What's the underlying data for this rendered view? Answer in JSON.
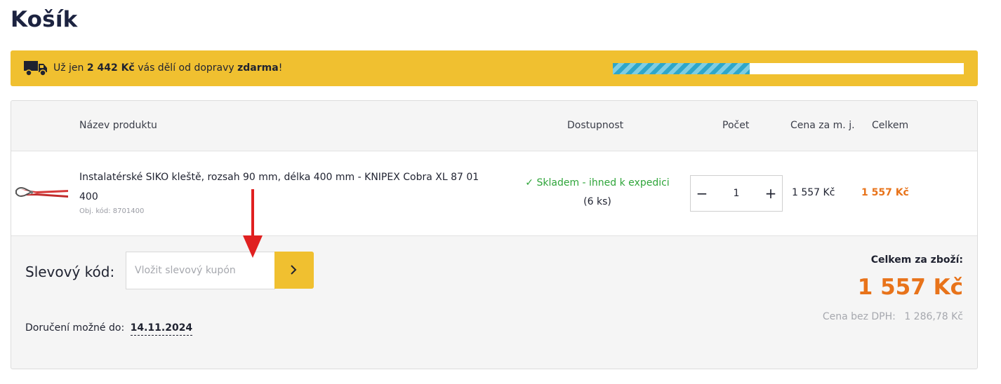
{
  "page": {
    "title": "Košík"
  },
  "shipping": {
    "prefix": "Už jen",
    "amount": "2 442 Kč",
    "middle": "vás dělí od dopravy",
    "free": "zdarma",
    "suffix": "!",
    "progress_fraction": 0.39,
    "icon": "truck-icon"
  },
  "table": {
    "headers": {
      "product": "Název produktu",
      "availability": "Dostupnost",
      "quantity": "Počet",
      "unit_price": "Cena za m. j.",
      "total": "Celkem"
    },
    "rows": [
      {
        "image_icon": "pliers-icon",
        "name": "Instalatérské SIKO kleště, rozsah 90 mm, délka 400 mm - KNIPEX Cobra XL 87 01 400",
        "code": "Obj. kód: 8701400",
        "availability": "✓ Skladem - ihned k expedici",
        "stock": "(6 ks)",
        "quantity": "1",
        "unit_price": "1 557 Kč",
        "total": "1 557 Kč"
      }
    ]
  },
  "coupon": {
    "label": "Slevový kód:",
    "placeholder": "Vložit slevový kupón",
    "submit_icon": "chevron-right-icon"
  },
  "delivery": {
    "label": "Doručení možné do:",
    "date": "14.11.2024"
  },
  "summary": {
    "label": "Celkem za zboží:",
    "total": "1 557 Kč",
    "no_vat_label": "Cena bez DPH:",
    "no_vat_value": "1 286,78 Kč"
  },
  "colors": {
    "accent_yellow": "#f0c030",
    "price_orange": "#e8731a",
    "stock_green": "#2fa53a",
    "progress_blue": "#2ea6c9",
    "annotation_red": "#e02020"
  }
}
